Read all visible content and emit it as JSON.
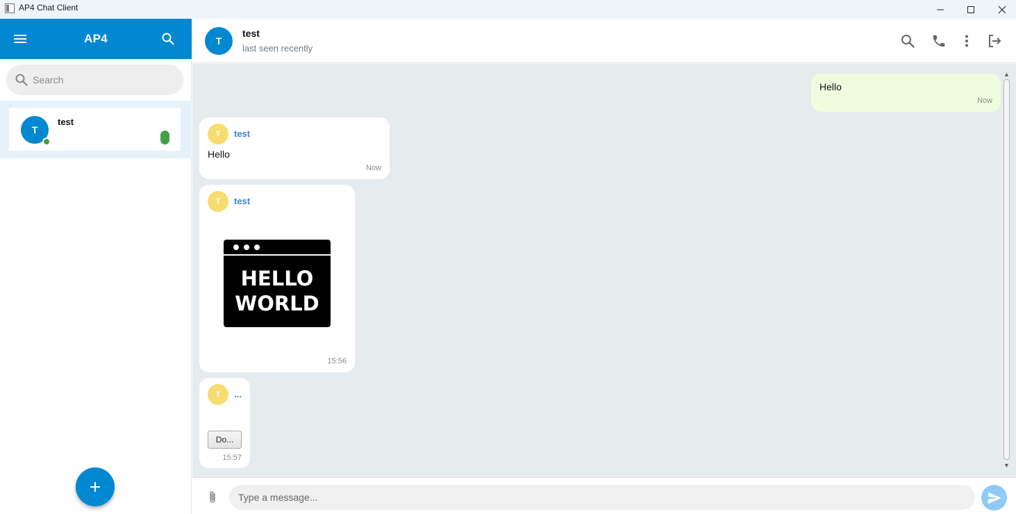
{
  "window": {
    "title": "AP4 Chat Client"
  },
  "sidebar": {
    "brand": "AP4",
    "search_placeholder": "Search",
    "chats": [
      {
        "avatar": "T",
        "name": "test",
        "online": true,
        "unread": true
      }
    ]
  },
  "header": {
    "avatar": "T",
    "name": "test",
    "status": "last seen recently"
  },
  "messages": [
    {
      "direction": "out",
      "text": "Hello",
      "time": "Now"
    },
    {
      "direction": "in",
      "avatar": "T",
      "sender": "test",
      "text": "Hello",
      "time": "Now"
    },
    {
      "direction": "in",
      "avatar": "T",
      "sender": "test",
      "image_text": [
        "HELLO",
        "WORLD"
      ],
      "time": "15:56"
    },
    {
      "direction": "in",
      "avatar": "T",
      "sender": "...",
      "attachment_label": "Do...",
      "time": "15:57"
    }
  ],
  "composer": {
    "placeholder": "Type a message..."
  },
  "colors": {
    "primary": "#0288d1",
    "chat_bg": "#e6ebee",
    "outgoing_bubble": "#effdde",
    "online": "#43a047",
    "sender_name": "#3a86c8",
    "avatar_yellow": "#f7dc6f"
  },
  "icons": [
    "hamburger-icon",
    "search-icon",
    "plus-icon",
    "phone-icon",
    "more-vert-icon",
    "logout-icon",
    "paperclip-icon",
    "send-icon"
  ]
}
